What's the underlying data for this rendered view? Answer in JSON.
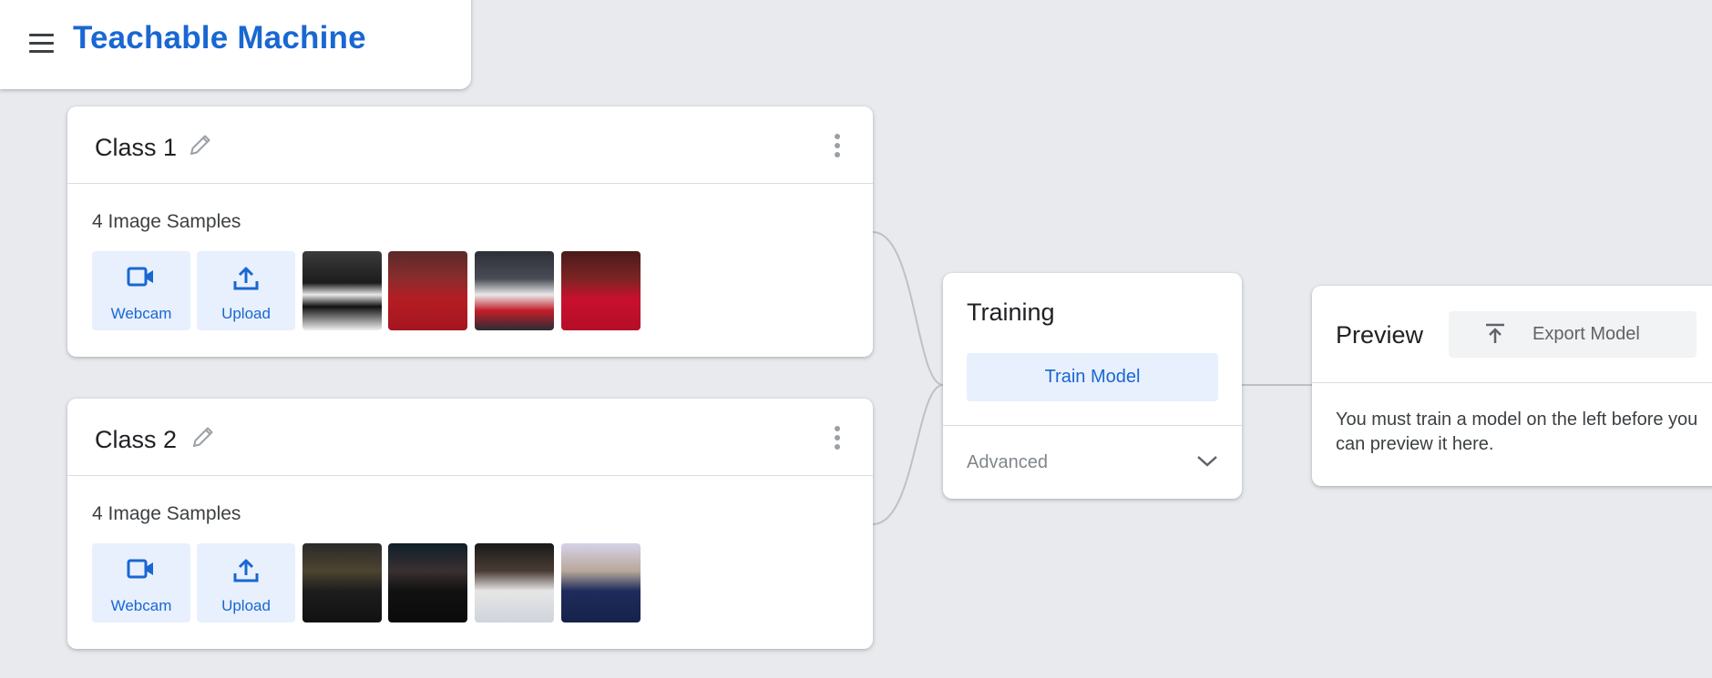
{
  "app": {
    "title": "Teachable Machine"
  },
  "classes": [
    {
      "name": "Class 1",
      "sample_count": "4 Image Samples",
      "webcam_label": "Webcam",
      "upload_label": "Upload",
      "thumbnails": [
        "player-photo-1",
        "player-photo-2",
        "player-photo-3",
        "player-photo-4"
      ]
    },
    {
      "name": "Class 2",
      "sample_count": "4 Image Samples",
      "webcam_label": "Webcam",
      "upload_label": "Upload",
      "thumbnails": [
        "player-photo-5",
        "player-photo-6",
        "player-photo-7",
        "player-photo-8"
      ]
    }
  ],
  "training": {
    "title": "Training",
    "train_button": "Train Model",
    "advanced_label": "Advanced"
  },
  "preview": {
    "title": "Preview",
    "export_button": "Export Model",
    "message": "You must train a model on the left before you can preview it here."
  },
  "colors": {
    "accent": "#1967d2",
    "button_bg": "#e8f0fe",
    "background": "#e8eaed",
    "connector": "#bdc1c6"
  }
}
